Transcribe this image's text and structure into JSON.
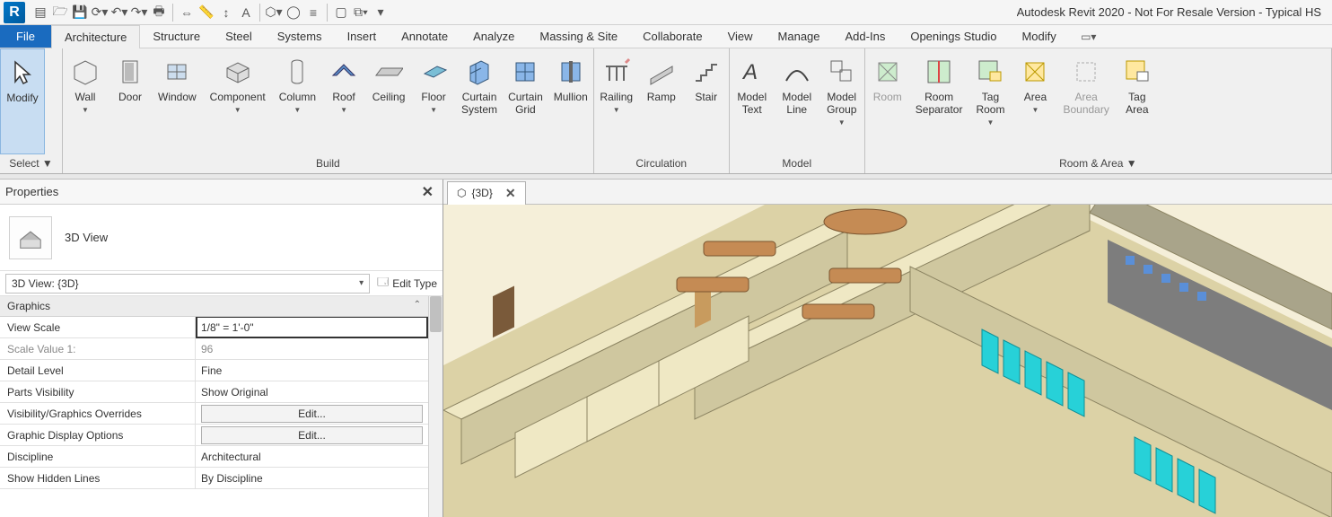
{
  "app": {
    "title": "Autodesk Revit 2020 - Not For Resale Version - Typical HS"
  },
  "menu": {
    "file": "File",
    "tabs": [
      "Architecture",
      "Structure",
      "Steel",
      "Systems",
      "Insert",
      "Annotate",
      "Analyze",
      "Massing & Site",
      "Collaborate",
      "View",
      "Manage",
      "Add-Ins",
      "Openings Studio",
      "Modify"
    ],
    "active": "Architecture"
  },
  "ribbon": {
    "select_panel": {
      "modify": "Modify",
      "label": "Select ▼"
    },
    "build": {
      "wall": "Wall",
      "door": "Door",
      "window": "Window",
      "component": "Component",
      "column": "Column",
      "roof": "Roof",
      "ceiling": "Ceiling",
      "floor": "Floor",
      "curtain_system": "Curtain\nSystem",
      "curtain_grid": "Curtain\nGrid",
      "mullion": "Mullion",
      "label": "Build"
    },
    "circulation": {
      "railing": "Railing",
      "ramp": "Ramp",
      "stair": "Stair",
      "label": "Circulation"
    },
    "model": {
      "model_text": "Model\nText",
      "model_line": "Model\nLine",
      "model_group": "Model\nGroup",
      "label": "Model"
    },
    "room_area": {
      "room": "Room",
      "room_separator": "Room\nSeparator",
      "tag_room": "Tag\nRoom",
      "area": "Area",
      "area_boundary": "Area\nBoundary",
      "tag_area": "Tag\nArea",
      "label": "Room & Area ▼"
    }
  },
  "properties": {
    "title": "Properties",
    "type_label": "3D View",
    "instance": "3D View: {3D}",
    "edit_type": "Edit Type",
    "category": "Graphics",
    "rows": [
      {
        "name": "View Scale",
        "value": "1/8\" = 1'-0\"",
        "kind": "combo",
        "hl": true
      },
      {
        "name": "Scale Value    1:",
        "value": "96",
        "kind": "ro"
      },
      {
        "name": "Detail Level",
        "value": "Fine",
        "kind": "text"
      },
      {
        "name": "Parts Visibility",
        "value": "Show Original",
        "kind": "text"
      },
      {
        "name": "Visibility/Graphics Overrides",
        "value": "Edit...",
        "kind": "btn"
      },
      {
        "name": "Graphic Display Options",
        "value": "Edit...",
        "kind": "btn"
      },
      {
        "name": "Discipline",
        "value": "Architectural",
        "kind": "text"
      },
      {
        "name": "Show Hidden Lines",
        "value": "By Discipline",
        "kind": "text"
      }
    ]
  },
  "view_tab": {
    "name": "{3D}"
  },
  "colors": {
    "accent": "#1a6bbf",
    "wall": "#e5dfb8",
    "floor": "#d8cd9e",
    "cubicle": "#27d1d8",
    "table": "#c58b54"
  }
}
